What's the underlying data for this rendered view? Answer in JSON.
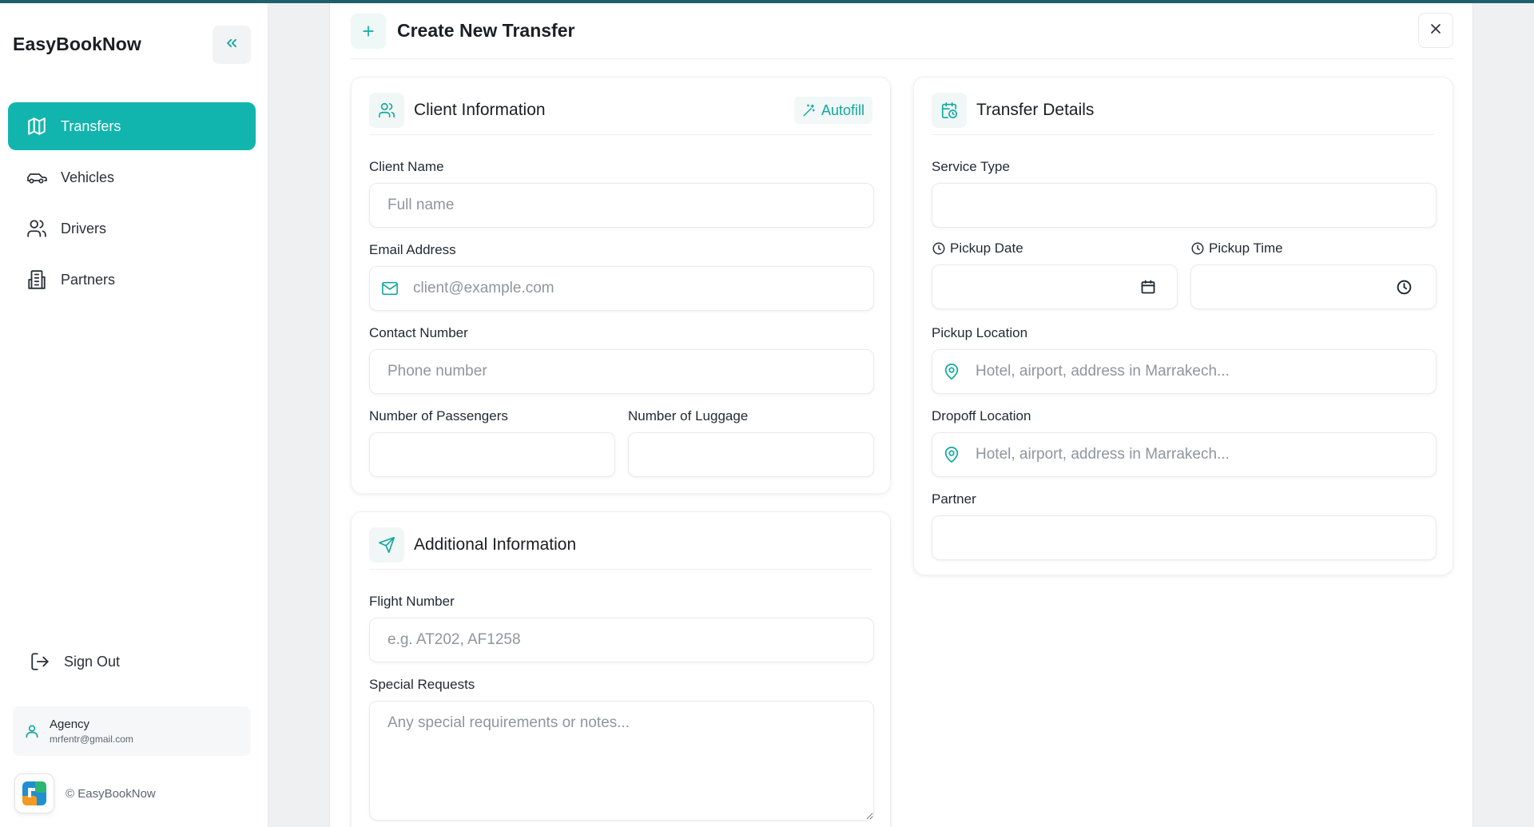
{
  "brand": {
    "name": "EasyBookNow"
  },
  "sidebar": {
    "items": [
      {
        "label": "Transfers",
        "icon": "map-icon",
        "active": true
      },
      {
        "label": "Vehicles",
        "icon": "car-icon",
        "active": false
      },
      {
        "label": "Drivers",
        "icon": "users-icon",
        "active": false
      },
      {
        "label": "Partners",
        "icon": "building-icon",
        "active": false
      }
    ],
    "sign_out": "Sign Out",
    "user": {
      "role": "Agency",
      "email": "mrfentr@gmail.com"
    },
    "copyright": "© EasyBookNow"
  },
  "modal": {
    "title": "Create New Transfer",
    "client": {
      "title": "Client Information",
      "autofill": "Autofill",
      "client_name_label": "Client Name",
      "client_name_placeholder": "Full name",
      "email_label": "Email Address",
      "email_placeholder": "client@example.com",
      "contact_label": "Contact Number",
      "contact_placeholder": "Phone number",
      "passengers_label": "Number of Passengers",
      "luggage_label": "Number of Luggage"
    },
    "additional": {
      "title": "Additional Information",
      "flight_label": "Flight Number",
      "flight_placeholder": "e.g. AT202, AF1258",
      "requests_label": "Special Requests",
      "requests_placeholder": "Any special requirements or notes..."
    },
    "transfer": {
      "title": "Transfer Details",
      "service_type_label": "Service Type",
      "pickup_date_label": "Pickup Date",
      "pickup_time_label": "Pickup Time",
      "pickup_location_label": "Pickup Location",
      "pickup_location_placeholder": "Hotel, airport, address in Marrakech...",
      "dropoff_location_label": "Dropoff Location",
      "dropoff_location_placeholder": "Hotel, airport, address in Marrakech...",
      "partner_label": "Partner"
    }
  },
  "colors": {
    "accent": "#12b5ad",
    "header_line": "#1f5f6b"
  }
}
